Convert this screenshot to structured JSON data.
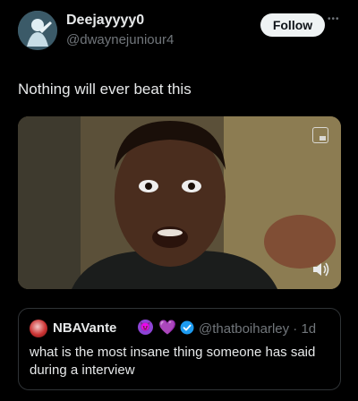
{
  "author": {
    "display_name": "Deejayyyy0",
    "handle": "@dwaynejuniour4",
    "avatar_icon": "avatar-image"
  },
  "actions": {
    "follow_label": "Follow",
    "more_icon": "more-dots-icon"
  },
  "tweet": {
    "text": "Nothing will ever beat this"
  },
  "media": {
    "type": "video",
    "pip_icon": "picture-in-picture-icon",
    "volume_icon": "volume-icon"
  },
  "quoted_tweet": {
    "display_name": "NBAVante",
    "emoji_1": "😈",
    "emoji_2": "💜",
    "verified_icon": "verified-badge-icon",
    "handle_time": "@thatboiharley · 1d",
    "text": "what is the most insane thing someone has said during a interview"
  },
  "colors": {
    "background": "#000000",
    "text": "#e7e9ea",
    "muted": "#71767b",
    "verified": "#1d9bf0",
    "border": "#2f3336"
  }
}
